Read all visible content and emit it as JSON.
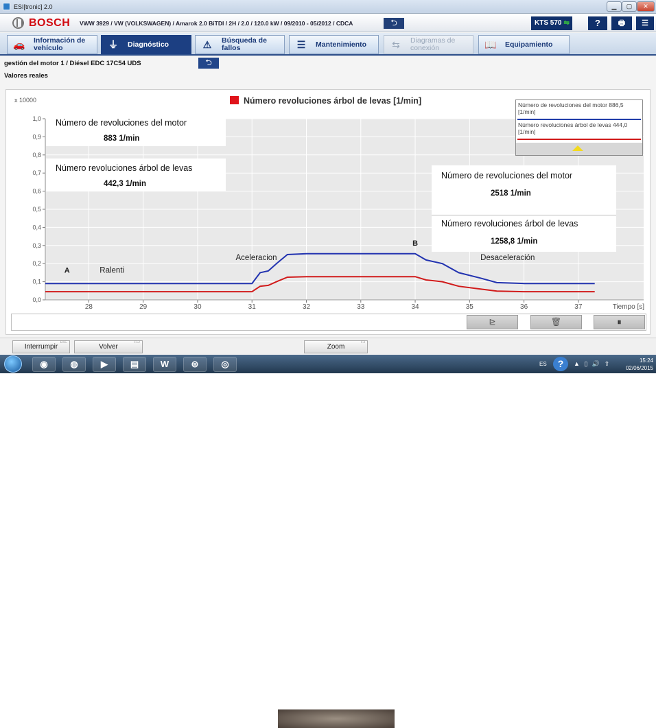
{
  "window": {
    "title": "ESI[tronic] 2.0",
    "min_glyph": "▁",
    "max_glyph": "▢",
    "close_glyph": "✕"
  },
  "header": {
    "brand": "BOSCH",
    "vehicle": "VWW 3929 / VW (VOLKSWAGEN) / Amarok 2.0 BiTDI / 2H / 2.0 / 120.0 kW / 09/2010 - 05/2012 / CDCA",
    "back_glyph": "⮌",
    "tester": "KTS 570",
    "usb_glyph": "⇋",
    "help_glyph": "?",
    "print_glyph": "🖶",
    "menu_glyph": "☰"
  },
  "tabs": [
    {
      "label": "Información de vehículo",
      "icon": "car-icon",
      "glyph": "🚗",
      "active": false,
      "disabled": false
    },
    {
      "label": "Diagnóstico",
      "icon": "diagnostic-plug-icon",
      "glyph": "⏚",
      "active": true,
      "disabled": false
    },
    {
      "label": "Búsqueda de fallos",
      "icon": "fault-search-icon",
      "glyph": "⚠",
      "active": false,
      "disabled": false
    },
    {
      "label": "Mantenimiento",
      "icon": "maintenance-icon",
      "glyph": "☰",
      "active": false,
      "disabled": false
    },
    {
      "label": "Diagramas de conexión",
      "icon": "wiring-diagram-icon",
      "glyph": "⇆",
      "active": false,
      "disabled": true
    },
    {
      "label": "Equipamiento",
      "icon": "book-icon",
      "glyph": "📖",
      "active": false,
      "disabled": false
    }
  ],
  "breadcrumb": "gestión del motor 1 / Diésel EDC 17C54 UDS",
  "breadcrumb_back_glyph": "⮌",
  "subtitle": "Valores reales",
  "overlays": {
    "left_rpm_label": "Número de revoluciones del motor",
    "left_rpm_value": "883 1/min",
    "left_cam_label": "Número revoluciones árbol de levas",
    "left_cam_value": "442,3 1/min",
    "right_rpm_label": "Número de revoluciones del motor",
    "right_rpm_value": "2518 1/min",
    "right_cam_label": "Número revoluciones árbol de levas",
    "right_cam_value": "1258,8 1/min"
  },
  "legend_box": {
    "entry1": "Número de revoluciones del motor 886,5 [1/min]",
    "entry2": "Número revoluciones árbol de levas 444,0 [1/min]"
  },
  "controls": {
    "cursor_glyph": "⊵",
    "delete_glyph": "🗑",
    "pause_glyph": "⏸"
  },
  "footer": {
    "interrupt_label": "Interrumpir",
    "interrupt_key": "ESC",
    "back_label": "Volver",
    "back_key": "F12",
    "zoom_label": "Zoom",
    "zoom_key": "F3"
  },
  "taskbar": {
    "apps": [
      {
        "icon": "chrome-icon",
        "glyph": "◉"
      },
      {
        "icon": "firefox-icon",
        "glyph": "◍"
      },
      {
        "icon": "media-player-icon",
        "glyph": "▶"
      },
      {
        "icon": "folder-icon",
        "glyph": "▤"
      },
      {
        "icon": "word-icon",
        "glyph": "W"
      },
      {
        "icon": "esitronic-icon",
        "glyph": "⊜"
      },
      {
        "icon": "disc-icon",
        "glyph": "◎"
      }
    ],
    "lang": "ES",
    "help_glyph": "?",
    "tray": "▲ ▯ 🔊 ⇧",
    "time": "15:24",
    "date": "02/06/2015"
  },
  "chart_data": {
    "type": "line",
    "title": "Número revoluciones árbol de levas [1/min]",
    "title_color": "#e0141b",
    "y_multiplier_label": "x 10000",
    "xlabel": "Tiempo [s]",
    "xlim": [
      27.2,
      38.2
    ],
    "ylim": [
      0,
      1.0
    ],
    "x_ticks": [
      28,
      29,
      30,
      31,
      32,
      33,
      34,
      35,
      36,
      37
    ],
    "y_ticks": [
      "0,0",
      "0,1",
      "0,2",
      "0,3",
      "0,4",
      "0,5",
      "0,6",
      "0,7",
      "0,8",
      "0,9",
      "1,0"
    ],
    "grid": true,
    "series": [
      {
        "name": "Número de revoluciones del motor",
        "color": "#2233b0",
        "x": [
          27.2,
          30.8,
          31.0,
          31.15,
          31.3,
          31.45,
          31.65,
          32.0,
          33.0,
          34.0,
          34.2,
          34.5,
          34.8,
          35.2,
          35.5,
          36.0,
          36.5,
          37.3
        ],
        "y": [
          0.09,
          0.09,
          0.09,
          0.15,
          0.16,
          0.2,
          0.25,
          0.255,
          0.255,
          0.255,
          0.22,
          0.2,
          0.15,
          0.12,
          0.095,
          0.09,
          0.09,
          0.09
        ]
      },
      {
        "name": "Número revoluciones árbol de levas",
        "color": "#d11b1b",
        "x": [
          27.2,
          30.8,
          31.0,
          31.15,
          31.3,
          31.45,
          31.65,
          32.0,
          33.0,
          34.0,
          34.2,
          34.5,
          34.8,
          35.2,
          35.5,
          36.0,
          36.5,
          37.3
        ],
        "y": [
          0.045,
          0.045,
          0.045,
          0.075,
          0.08,
          0.1,
          0.125,
          0.128,
          0.128,
          0.128,
          0.11,
          0.1,
          0.075,
          0.06,
          0.048,
          0.045,
          0.045,
          0.045
        ]
      }
    ],
    "annotations": [
      {
        "text": "A",
        "x": 27.55,
        "y": 0.15,
        "bold": true
      },
      {
        "text": "Ralenti",
        "x": 28.2,
        "y": 0.15,
        "bold": false
      },
      {
        "text": "Aceleracion",
        "x": 30.7,
        "y": 0.22,
        "bold": false
      },
      {
        "text": "B",
        "x": 33.95,
        "y": 0.3,
        "bold": true
      },
      {
        "text": "Desaceleración",
        "x": 35.2,
        "y": 0.22,
        "bold": false
      }
    ]
  }
}
